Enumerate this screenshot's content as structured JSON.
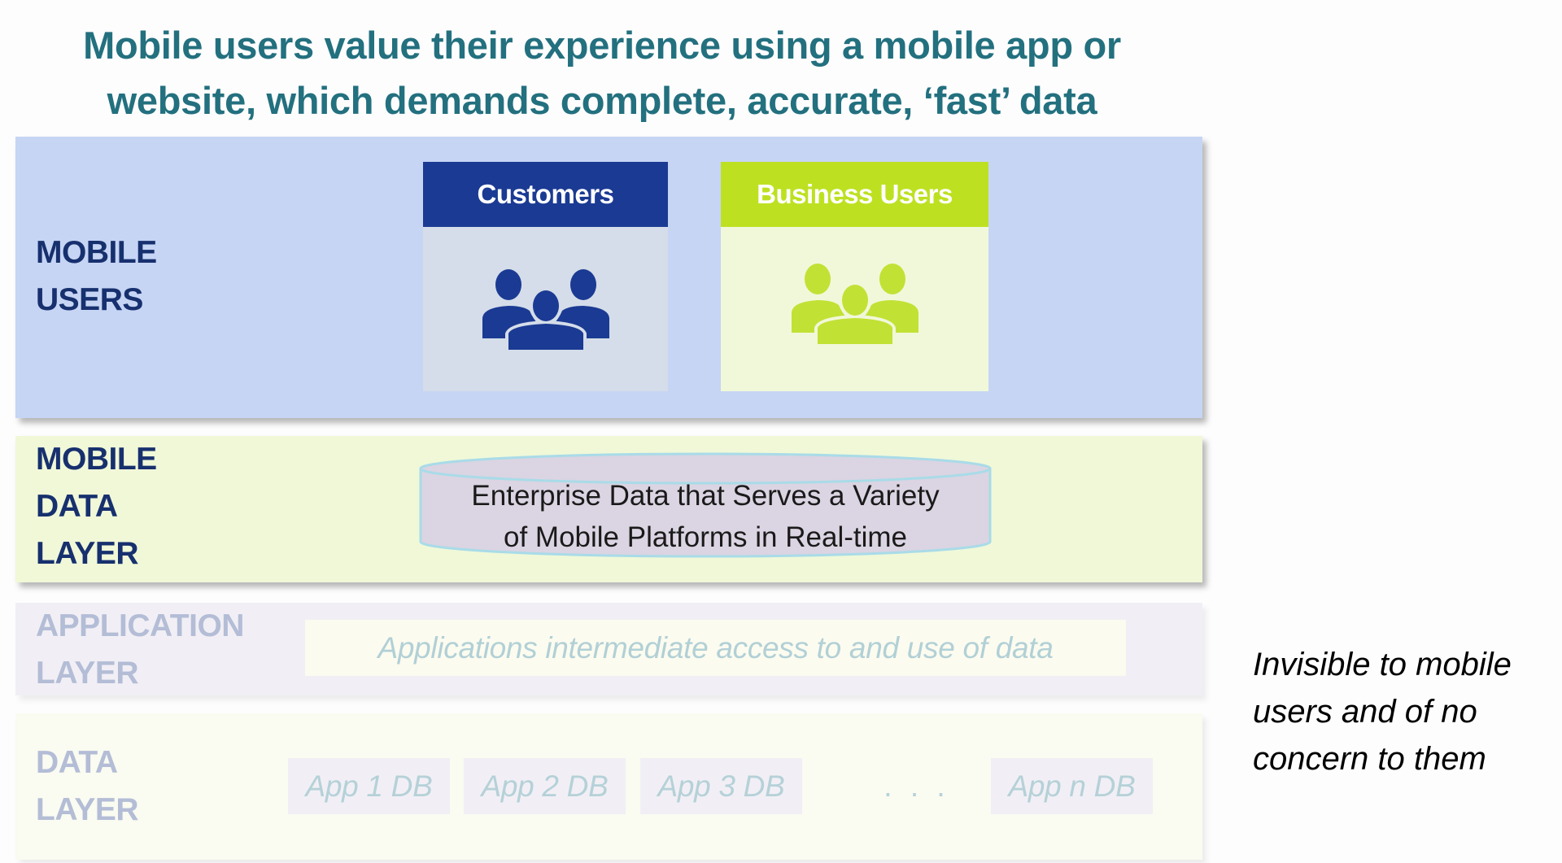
{
  "title": {
    "line1": "Mobile users value their experience using a mobile app or",
    "line2": "website, which demands complete, accurate, ‘fast’ data"
  },
  "layers": {
    "mobile_users": {
      "label_line1": "MOBILE",
      "label_line2": "USERS",
      "cards": [
        {
          "title": "Customers",
          "icon": "users-group-icon"
        },
        {
          "title": "Business Users",
          "icon": "users-group-icon"
        }
      ]
    },
    "mobile_data_layer": {
      "label_line1": "MOBILE",
      "label_line2": "DATA",
      "label_line3": "LAYER",
      "store_line1": "Enterprise Data that Serves a Variety",
      "store_line2": "of Mobile Platforms in Real-time",
      "store_icon": "database-cylinder-icon"
    },
    "application_layer": {
      "label_line1": "APPLICATION",
      "label_line2": "LAYER",
      "description": "Applications intermediate access to and use of data"
    },
    "data_layer": {
      "label_line1": "DATA",
      "label_line2": "LAYER",
      "databases": [
        "App 1 DB",
        "App 2 DB",
        "App 3 DB",
        "App n DB"
      ],
      "ellipsis": ". . ."
    }
  },
  "side_note": {
    "line1": "Invisible to mobile",
    "line2": "users and of no",
    "line3": "concern to them"
  },
  "colors": {
    "title": "#23707f",
    "dark_navy": "#1b3a93",
    "lime": "#bde121",
    "mobile_users_bg": "#c6d5f4",
    "mobile_data_bg": "#f0f8d8",
    "application_bg": "#f1eff5",
    "data_layer_bg": "#fafbf1",
    "faded_label": "#b4bdd6"
  }
}
